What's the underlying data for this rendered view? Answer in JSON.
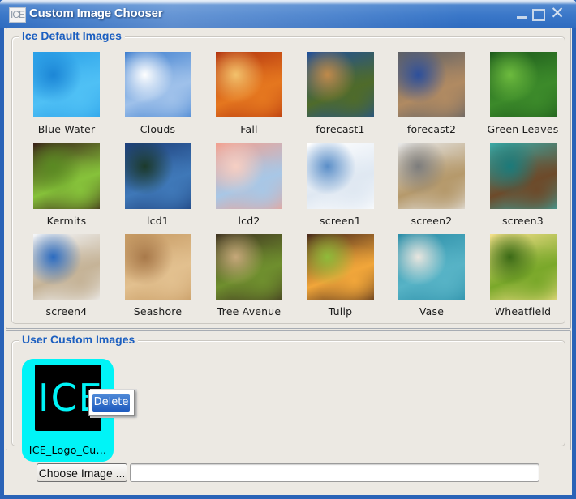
{
  "window": {
    "title": "Custom Image Chooser",
    "app_icon_text": "ICE",
    "controls": {
      "minimize": "minimize",
      "maximize": "maximize",
      "close": "✕"
    }
  },
  "default_images": {
    "legend": "Ice Default Images",
    "items": [
      {
        "label": "Blue Water",
        "colors": [
          "#2aa0e8",
          "#4fc0f5",
          "#1c86d6"
        ]
      },
      {
        "label": "Clouds",
        "colors": [
          "#3f7fcf",
          "#9fc1ea",
          "#ffffff"
        ]
      },
      {
        "label": "Fall",
        "colors": [
          "#b2320e",
          "#e5771f",
          "#f3c26c"
        ]
      },
      {
        "label": "forecast1",
        "colors": [
          "#1e4f9b",
          "#4f6b2a",
          "#c08a4a"
        ]
      },
      {
        "label": "forecast2",
        "colors": [
          "#5d6066",
          "#b08a62",
          "#2c4f9c"
        ]
      },
      {
        "label": "Green Leaves",
        "colors": [
          "#1d5a1c",
          "#3c8a2a",
          "#6dbb3e"
        ]
      },
      {
        "label": "Kermits",
        "colors": [
          "#3a2218",
          "#86c23a",
          "#5a8a22"
        ]
      },
      {
        "label": "lcd1",
        "colors": [
          "#1d3f7a",
          "#3f78b8",
          "#1c3a2b"
        ]
      },
      {
        "label": "lcd2",
        "colors": [
          "#f2a08f",
          "#a8c7e6",
          "#f6cfc3"
        ]
      },
      {
        "label": "screen1",
        "colors": [
          "#ffffff",
          "#dfe8f2",
          "#5a8ec8"
        ]
      },
      {
        "label": "screen2",
        "colors": [
          "#e8e8e8",
          "#b5996b",
          "#7c7c7c"
        ]
      },
      {
        "label": "screen3",
        "colors": [
          "#3aa9a6",
          "#6d4a2a",
          "#1b7a7a"
        ]
      },
      {
        "label": "screen4",
        "colors": [
          "#f4f6f9",
          "#c5b397",
          "#2b6bc0"
        ]
      },
      {
        "label": "Seashore",
        "colors": [
          "#c69a63",
          "#e2c08f",
          "#a8794a"
        ]
      },
      {
        "label": "Tree Avenue",
        "colors": [
          "#3f3320",
          "#6f8f2e",
          "#c6a87a"
        ]
      },
      {
        "label": "Tulip",
        "colors": [
          "#4a2a1a",
          "#f1a63a",
          "#8fbb3a"
        ]
      },
      {
        "label": "Vase",
        "colors": [
          "#2c8ea8",
          "#57b3c6",
          "#e9e6df"
        ]
      },
      {
        "label": "Wheatfield",
        "colors": [
          "#f4e08a",
          "#7aa82a",
          "#3b6a16"
        ]
      }
    ]
  },
  "user_images": {
    "legend": "User Custom Images",
    "items": [
      {
        "label": "ICE_Logo_Cu...",
        "logo_text": "ICE",
        "selected": true
      }
    ],
    "context_menu": {
      "items": [
        "Delete"
      ]
    }
  },
  "bottom": {
    "choose_button": "Choose Image ...",
    "path_value": ""
  },
  "theme": {
    "title_bar": "#3b78c9",
    "legend_text": "#1c5fc0",
    "selection": "#00f4f7"
  }
}
